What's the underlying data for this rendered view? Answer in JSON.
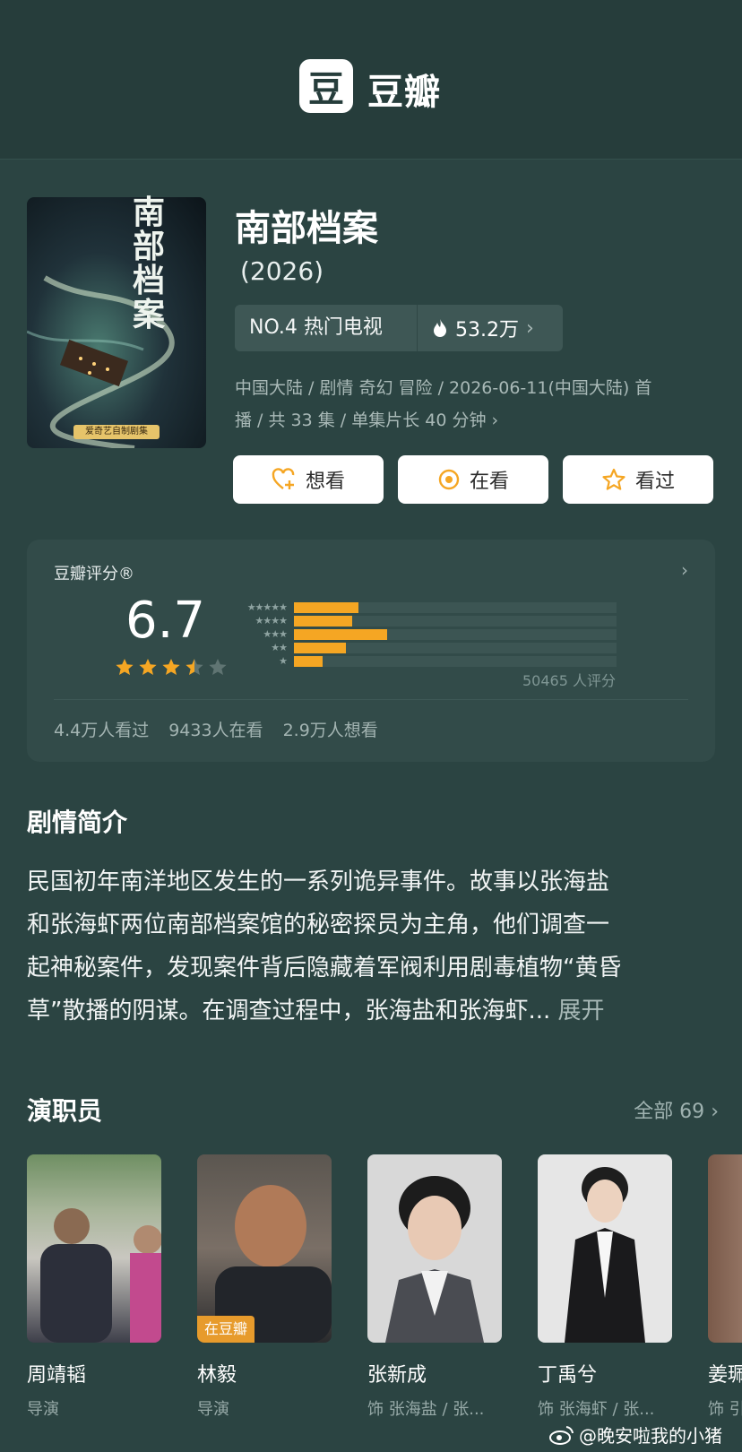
{
  "app": {
    "logo_char": "豆",
    "name": "豆瓣"
  },
  "show": {
    "title": "南部档案",
    "year": "(2026)",
    "poster_title": "南部档案",
    "poster_badge": "爱奇艺自制剧集",
    "rank_label": "NO.4 热门电视",
    "hot_count": "53.2万",
    "meta_line1": "中国大陆 / 剧情 奇幻 冒险 / 2026-06-11(中国大陆) 首",
    "meta_line2": "播 / 共 33 集 / 单集片长 40 分钟"
  },
  "actions": {
    "want": "想看",
    "watching": "在看",
    "watched": "看过"
  },
  "rating": {
    "title": "豆瓣评分®",
    "score": "6.7",
    "stars": 3.5,
    "distribution": [
      {
        "stars": 5,
        "label": "★★★★★",
        "percent": 20
      },
      {
        "stars": 4,
        "label": "★★★★",
        "percent": 18
      },
      {
        "stars": 3,
        "label": "★★★",
        "percent": 29
      },
      {
        "stars": 2,
        "label": "★★",
        "percent": 16
      },
      {
        "stars": 1,
        "label": "★",
        "percent": 9
      }
    ],
    "count": "50465 人评分",
    "watched": "4.4万人看过",
    "watching": "9433人在看",
    "want": "2.9万人想看"
  },
  "synopsis": {
    "title": "剧情简介",
    "line1": "民国初年南洋地区发生的一系列诡异事件。故事以张海盐",
    "line2": "和张海虾两位南部档案馆的秘密探员为主角，他们调查一",
    "line3": "起神秘案件，发现案件背后隐藏着军阀利用剧毒植物“黄昏",
    "line4": "草”散播的阴谋。在调查过程中，张海盐和张海虾... ",
    "expand": "展开"
  },
  "cast": {
    "title": "演职员",
    "all": "全部 69",
    "members": [
      {
        "name": "周靖韬",
        "role": "导演",
        "tag": ""
      },
      {
        "name": "林毅",
        "role": "导演",
        "tag": "在豆瓣"
      },
      {
        "name": "张新成",
        "role": "饰 张海盐 / 张...",
        "tag": ""
      },
      {
        "name": "丁禹兮",
        "role": "饰 张海虾 / 张...",
        "tag": ""
      },
      {
        "name": "姜珮",
        "role": "饰 引",
        "tag": ""
      }
    ]
  },
  "watermark": "@晚安啦我的小猪",
  "colors": {
    "background": "#2b4442",
    "accent": "#f5a623",
    "card": "#324b49"
  }
}
